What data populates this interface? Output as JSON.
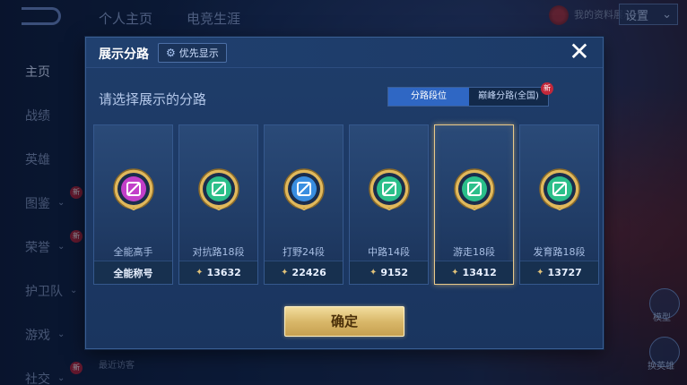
{
  "background": {
    "top_tabs": [
      "个人主页",
      "电竞生涯"
    ],
    "settings_label": "设置",
    "top_right_text": "我的资料展示",
    "sidebar": [
      {
        "label": "主页",
        "active": true,
        "chevron": false,
        "new": false
      },
      {
        "label": "战绩",
        "active": false,
        "chevron": false,
        "new": false
      },
      {
        "label": "英雄",
        "active": false,
        "chevron": false,
        "new": false
      },
      {
        "label": "图鉴",
        "active": false,
        "chevron": true,
        "new": true
      },
      {
        "label": "荣誉",
        "active": false,
        "chevron": true,
        "new": true
      },
      {
        "label": "护卫队",
        "active": false,
        "chevron": true,
        "new": false
      },
      {
        "label": "游戏",
        "active": false,
        "chevron": true,
        "new": false
      },
      {
        "label": "社交",
        "active": false,
        "chevron": true,
        "new": true
      }
    ],
    "new_badge": "新",
    "recent_visitors": "最近访客",
    "right_labels": [
      "模型",
      "换英雄"
    ]
  },
  "modal": {
    "title": "展示分路",
    "priority_button": "优先显示",
    "subtitle": "请选择展示的分路",
    "toggle": {
      "active": "分路段位",
      "inactive": "巅峰分路(全国)",
      "new_badge": "新"
    },
    "cards": [
      {
        "name": "全能高手",
        "foot": "全能称号",
        "has_score": false,
        "badge_color": "#c23fc9",
        "selected": false
      },
      {
        "name": "对抗路18段",
        "foot": "13632",
        "has_score": true,
        "badge_color": "#2bbf8a",
        "selected": false
      },
      {
        "name": "打野24段",
        "foot": "22426",
        "has_score": true,
        "badge_color": "#3a8ee0",
        "selected": false
      },
      {
        "name": "中路14段",
        "foot": "9152",
        "has_score": true,
        "badge_color": "#2bbf8a",
        "selected": false
      },
      {
        "name": "游走18段",
        "foot": "13412",
        "has_score": true,
        "badge_color": "#2bbf8a",
        "selected": true
      },
      {
        "name": "发育路18段",
        "foot": "13727",
        "has_score": true,
        "badge_color": "#2bbf8a",
        "selected": false
      }
    ],
    "confirm_label": "确定",
    "close_icon": "close-icon",
    "colors": {
      "accent_blue": "#2f67c4",
      "gold": "#d9b86a",
      "selected_border": "#e8c98a"
    }
  }
}
